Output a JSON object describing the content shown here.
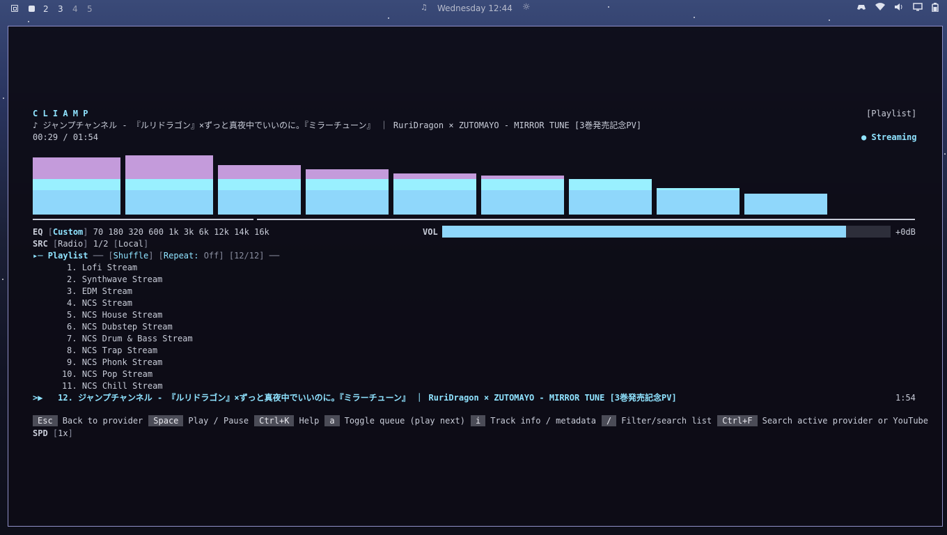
{
  "topbar": {
    "workspaces": [
      "2",
      "3",
      "4",
      "5"
    ],
    "clock": "Wednesday 12:44",
    "icons": [
      "workspace-grid-icon",
      "workspace-active-icon",
      "bell-icon",
      "sun-icon",
      "gamepad-icon",
      "wifi-icon",
      "volume-icon",
      "monitor-icon",
      "battery-icon"
    ]
  },
  "player": {
    "app_title": "C L I A M P",
    "mode_tag": "[Playlist]",
    "now_playing_prefix": "♪",
    "now_playing": "ジャンプチャンネル - 『ルリドラゴン』×ずっと真夜中でいいのに。『ミラーチューン』 ｜ RuriDragon × ZUTOMAYO - MIRROR TUNE [3巻発売記念PV]",
    "elapsed": "00:29",
    "duration": "01:54",
    "time_sep": "/",
    "status": "Streaming",
    "progress_fraction": 0.25
  },
  "visualizer": {
    "type": "bar",
    "values": [
      0.97,
      1.0,
      0.84,
      0.76,
      0.69,
      0.66,
      0.6,
      0.45,
      0.35
    ],
    "colors": {
      "top": "#c49bdb",
      "mid": "#99f0ff",
      "base": "#8fd7fb"
    }
  },
  "eq": {
    "label": "EQ",
    "preset": "Custom",
    "bands": [
      "70",
      "180",
      "320",
      "600",
      "1k",
      "3k",
      "6k",
      "12k",
      "14k",
      "16k"
    ]
  },
  "volume": {
    "label": "VOL",
    "fraction": 0.9,
    "db": "+0dB"
  },
  "src": {
    "label": "SRC",
    "radio": "Radio",
    "index": "1/2",
    "local": "Local"
  },
  "playlist_header": {
    "title": "Playlist",
    "shuffle": "Shuffle",
    "repeat_label": "Repeat:",
    "repeat_value": "Off",
    "count": "12/12"
  },
  "playlist": [
    {
      "num": "1.",
      "title": "Lofi Stream"
    },
    {
      "num": "2.",
      "title": "Synthwave Stream"
    },
    {
      "num": "3.",
      "title": "EDM Stream"
    },
    {
      "num": "4.",
      "title": "NCS Stream"
    },
    {
      "num": "5.",
      "title": "NCS House Stream"
    },
    {
      "num": "6.",
      "title": "NCS Dubstep Stream"
    },
    {
      "num": "7.",
      "title": "NCS Drum & Bass Stream"
    },
    {
      "num": "8.",
      "title": "NCS Trap Stream"
    },
    {
      "num": "9.",
      "title": "NCS Phonk Stream"
    },
    {
      "num": "10.",
      "title": "NCS Pop Stream"
    },
    {
      "num": "11.",
      "title": "NCS Chill Stream"
    }
  ],
  "current_track": {
    "marker": ">▶",
    "num": "12.",
    "title": "ジャンプチャンネル - 『ルリドラゴン』×ずっと真夜中でいいのに。『ミラーチューン』 ｜ RuriDragon × ZUTOMAYO - MIRROR TUNE [3巻発売記念PV]",
    "duration": "1:54"
  },
  "shortcuts": [
    {
      "key": "Esc",
      "label": "Back to provider"
    },
    {
      "key": "Space",
      "label": "Play / Pause"
    },
    {
      "key": "Ctrl+K",
      "label": "Help"
    },
    {
      "key": "a",
      "label": "Toggle queue (play next)"
    },
    {
      "key": "i",
      "label": "Track info / metadata"
    },
    {
      "key": "/",
      "label": "Filter/search list"
    },
    {
      "key": "Ctrl+F",
      "label": "Search active provider or YouTube"
    }
  ],
  "speed": {
    "label": "SPD",
    "value": "1x"
  }
}
